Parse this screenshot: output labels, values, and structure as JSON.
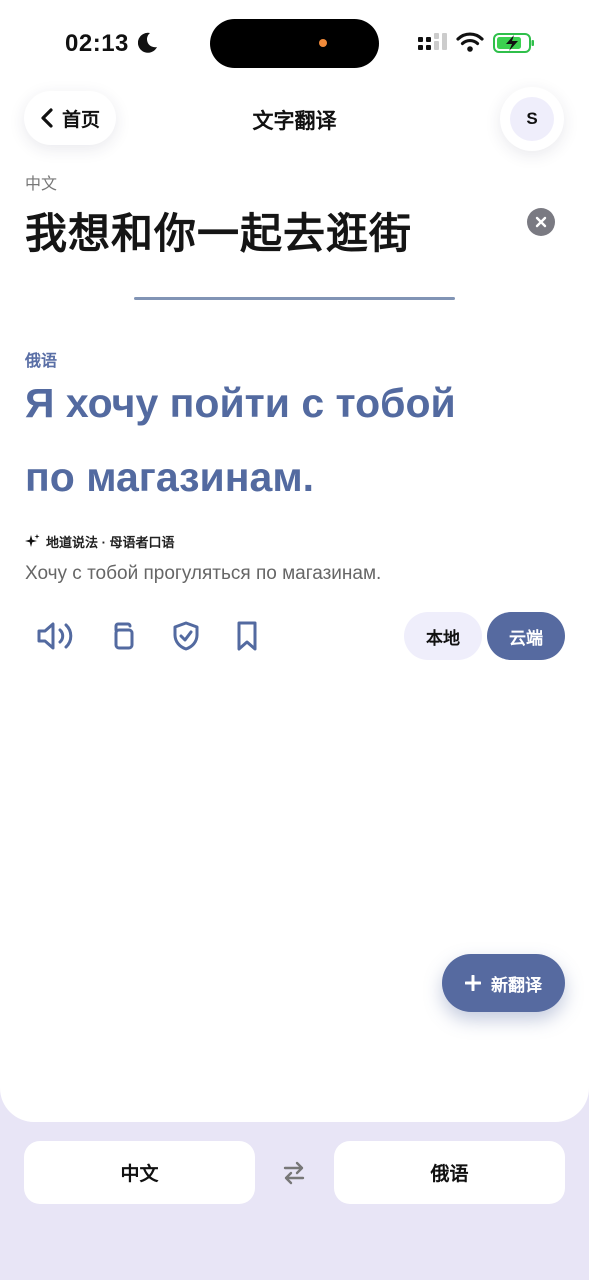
{
  "status_bar": {
    "time": "02:13"
  },
  "header": {
    "back_label": "首页",
    "title": "文字翻译",
    "avatar_initial": "S"
  },
  "source": {
    "language": "中文",
    "text": "我想和你一起去逛街"
  },
  "target": {
    "language": "俄语",
    "line1": "Я хочу пойти с тобой",
    "line2": "по магазинам.",
    "native_label": "地道说法 · 母语者口语",
    "alternative": "Хочу с тобой прогуляться по магазинам."
  },
  "actions": {
    "icons": [
      "speaker-icon",
      "copy-icon",
      "shield-check-icon",
      "bookmark-icon"
    ],
    "mode_local": "本地",
    "mode_cloud": "云端",
    "active_mode": "云端"
  },
  "fab": {
    "label": "新翻译"
  },
  "bottom_bar": {
    "from_lang": "中文",
    "to_lang": "俄语"
  },
  "colors": {
    "accent": "#566aa0",
    "bottom_bg": "#e8e5f6",
    "pill_light": "#efeefb"
  }
}
